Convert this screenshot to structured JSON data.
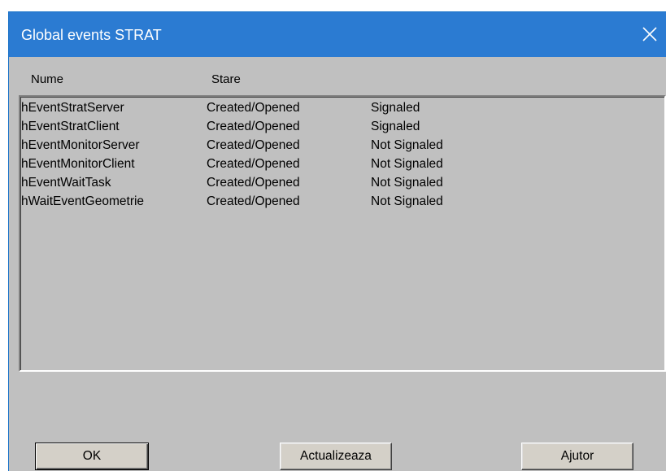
{
  "window": {
    "title": "Global events STRAT",
    "close_icon": "close-icon"
  },
  "list": {
    "columns": [
      "Nume",
      "Stare"
    ],
    "rows": [
      {
        "name": "hEventStratServer",
        "state": "Created/Opened",
        "signal": "Signaled"
      },
      {
        "name": "hEventStratClient",
        "state": "Created/Opened",
        "signal": "Signaled"
      },
      {
        "name": "hEventMonitorServer",
        "state": "Created/Opened",
        "signal": "Not Signaled"
      },
      {
        "name": "hEventMonitorClient",
        "state": "Created/Opened",
        "signal": "Not Signaled"
      },
      {
        "name": "hEventWaitTask",
        "state": "Created/Opened",
        "signal": "Not Signaled"
      },
      {
        "name": "hWaitEventGeometrie",
        "state": "Created/Opened",
        "signal": "Not Signaled"
      }
    ]
  },
  "buttons": {
    "ok": "OK",
    "refresh": "Actualizeaza",
    "help": "Ajutor"
  },
  "colors": {
    "titlebar": "#2b7bd2",
    "dialog_bg": "#c0c0c0"
  }
}
